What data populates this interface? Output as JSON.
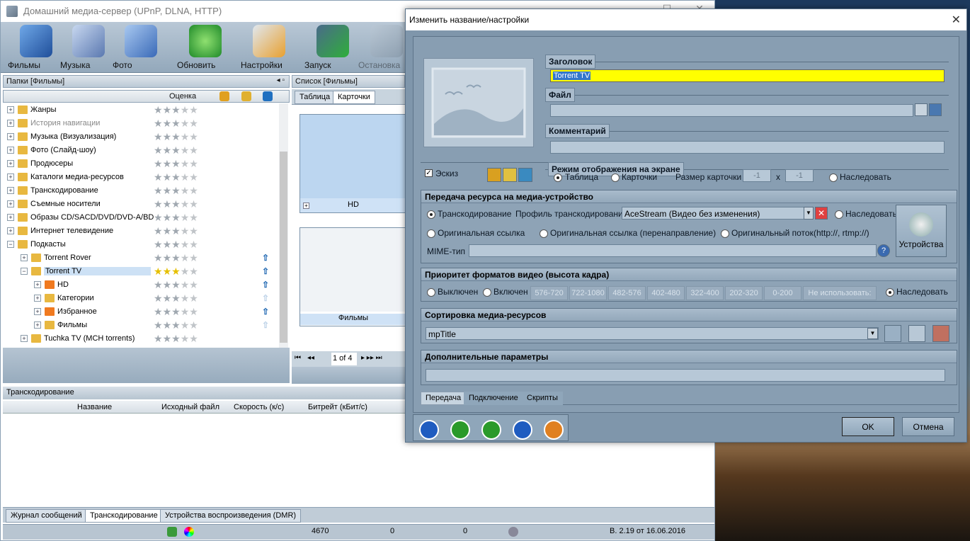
{
  "main": {
    "title": "Домашний медиа-сервер (UPnP, DLNA, HTTP)",
    "toolbar": [
      "Фильмы",
      "Музыка",
      "Фото",
      "Обновить",
      "Настройки",
      "Запуск",
      "Остановка"
    ],
    "folders_header": "Папки [Фильмы]",
    "rating_header": "Оценка",
    "list_header": "Список [Фильмы]",
    "tabs": [
      "Таблица",
      "Карточки"
    ],
    "tree": [
      {
        "label": "Жанры",
        "stars": 3
      },
      {
        "label": "История навигации",
        "stars": 3
      },
      {
        "label": "Музыка (Визуализация)",
        "stars": 3
      },
      {
        "label": "Фото (Слайд-шоу)",
        "stars": 3
      },
      {
        "label": "Продюсеры",
        "stars": 3
      },
      {
        "label": "Каталоги медиа-ресурсов",
        "stars": 3
      },
      {
        "label": "Транскодирование",
        "stars": 3
      },
      {
        "label": "Съемные носители",
        "stars": 3
      },
      {
        "label": "Образы CD/SACD/DVD/DVD-A/BD",
        "stars": 3
      },
      {
        "label": "Интернет телевидение",
        "stars": 3
      },
      {
        "label": "Подкасты",
        "stars": 3
      },
      {
        "label": "Torrent Rover",
        "stars": 3
      },
      {
        "label": "Torrent TV",
        "stars": 3
      },
      {
        "label": "HD",
        "stars": 3
      },
      {
        "label": "Категории",
        "stars": 3
      },
      {
        "label": "Избранное",
        "stars": 3
      },
      {
        "label": "Фильмы",
        "stars": 3
      },
      {
        "label": "Tuchka TV (MCH torrents)",
        "stars": 3
      }
    ],
    "cards": [
      "HD",
      "Фильмы"
    ],
    "pager": "1 of 4",
    "trans_title": "Транскодирование",
    "trans_cols": [
      "Название",
      "Исходный файл",
      "Скорость (к/с)",
      "Битрейт (кБит/с)"
    ],
    "bottom_tabs": [
      "Журнал сообщений",
      "Транскодирование",
      "Устройства воспроизведения (DMR)"
    ],
    "status": {
      "count1": "4670",
      "count2": "0",
      "count3": "0",
      "version": "В. 2.19 от 16.06.2016"
    }
  },
  "dialog": {
    "title": "Изменить название/настройки",
    "header_label": "Заголовок",
    "header_value": "Torrent TV",
    "file_label": "Файл",
    "comment_label": "Комментарий",
    "display_mode_label": "Режим отображения на экране",
    "sketch_label": "Эскиз",
    "mode_table": "Таблица",
    "mode_cards": "Карточки",
    "card_size_label": "Размер карточки",
    "card_w": "-1",
    "card_x": "x",
    "card_h": "-1",
    "inherit": "Наследовать",
    "transfer_group": "Передача ресурса на медиа-устройство",
    "transcoding": "Транскодирование",
    "profile_label": "Профиль транскодирования",
    "profile_value": "AceStream (Видео без изменения)",
    "orig_link": "Оригинальная ссылка",
    "orig_link_redirect": "Оригинальная ссылка (перенаправление)",
    "orig_stream": "Оригинальный поток",
    "orig_stream_hint": "(http://, rtmp://)",
    "mime_label": "MIME-тип",
    "devices_btn": "Устройства",
    "priority_group": "Приоритет форматов видео (высота кадра)",
    "off": "Выключен",
    "on": "Включен",
    "resolutions": [
      "576-720",
      "722-1080",
      "482-576",
      "402-480",
      "322-400",
      "202-320",
      "0-200",
      "Не использовать:"
    ],
    "sort_group": "Сортировка медиа-ресурсов",
    "sort_value": "mpTitle",
    "extra_group": "Дополнительные параметры",
    "tabs": [
      "Передача",
      "Подключение",
      "Скрипты"
    ],
    "ok": "OK",
    "cancel": "Отмена"
  }
}
